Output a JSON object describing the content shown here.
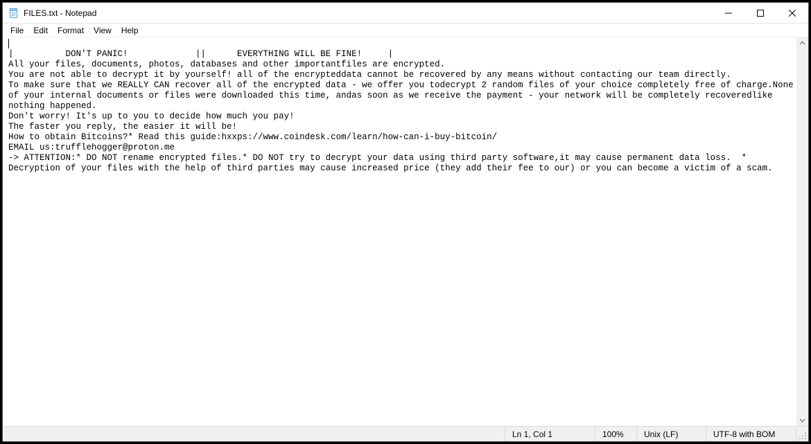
{
  "window": {
    "title": "FILES.txt - Notepad"
  },
  "menu": {
    "file": "File",
    "edit": "Edit",
    "format": "Format",
    "view": "View",
    "help": "Help"
  },
  "document": {
    "text": "|          DON'T PANIC!             ||      EVERYTHING WILL BE FINE!     |\nAll your files, documents, photos, databases and other importantfiles are encrypted.\nYou are not able to decrypt it by yourself! all of the encrypteddata cannot be recovered by any means without contacting our team directly.\nTo make sure that we REALLY CAN recover all of the encrypted data - we offer you todecrypt 2 random files of your choice completely free of charge.None of your internal documents or files were downloaded this time, andas soon as we receive the payment - your network will be completely recoveredlike nothing happened.\nDon't worry! It's up to you to decide how much you pay!\nThe faster you reply, the easier it will be!\nHow to obtain Bitcoins?* Read this guide:hxxps://www.coindesk.com/learn/how-can-i-buy-bitcoin/\nEMAIL us:trufflehogger@proton.me\n-> ATTENTION:* DO NOT rename encrypted files.* DO NOT try to decrypt your data using third party software,it may cause permanent data loss.  * Decryption of your files with the help of third parties may cause increased price (they add their fee to our) or you can become a victim of a scam."
  },
  "status": {
    "position": "Ln 1, Col 1",
    "zoom": "100%",
    "eol": "Unix (LF)",
    "encoding": "UTF-8 with BOM"
  }
}
